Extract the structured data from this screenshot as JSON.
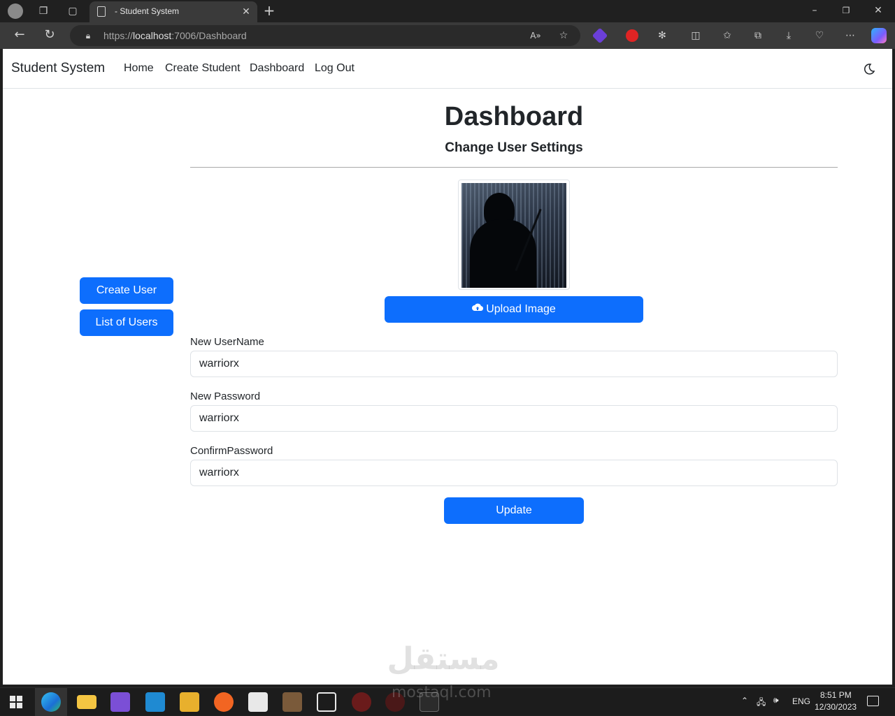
{
  "browser": {
    "tab_title": "- Student System",
    "url_prefix": "https://",
    "url_host": "localhost",
    "url_rest": ":7006/Dashboard"
  },
  "navbar": {
    "brand": "Student System",
    "links": [
      "Home",
      "Create Student",
      "Dashboard",
      "Log Out"
    ]
  },
  "sidebar": {
    "create_user": "Create User",
    "list_users": "List of Users"
  },
  "main": {
    "title": "Dashboard",
    "subtitle": "Change User Settings",
    "upload_button": "Upload Image",
    "fields": [
      {
        "label": "New UserName",
        "value": "warriorx"
      },
      {
        "label": "New Password",
        "value": "warriorx"
      },
      {
        "label": "ConfirmPassword",
        "value": "warriorx"
      }
    ],
    "update_button": "Update"
  },
  "watermark": {
    "arabic": "مستقل",
    "latin": "mostaql.com"
  },
  "taskbar": {
    "lang": "ENG",
    "time": "8:51 PM",
    "date": "12/30/2023"
  },
  "colors": {
    "primary": "#0d6efd",
    "text": "#212529",
    "border": "#dee2e6"
  }
}
